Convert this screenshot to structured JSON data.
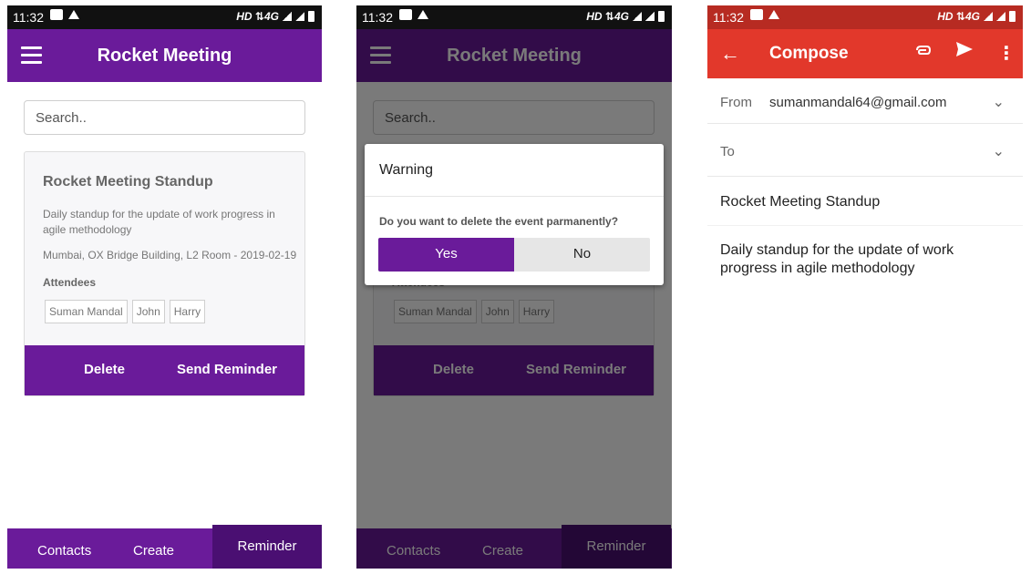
{
  "status_bar": {
    "time": "11:32",
    "network": "HD ⇅4G"
  },
  "app": {
    "title": "Rocket Meeting"
  },
  "search": {
    "placeholder": "Search.."
  },
  "event": {
    "title": "Rocket Meeting Standup",
    "description": "Daily standup for the update of work progress in agile methodology",
    "location_date": "Mumbai, OX Bridge Building, L2 Room - 2019-02-19",
    "attendees_label": "Attendees",
    "attendees": [
      "Suman Mandal",
      "John",
      "Harry"
    ],
    "delete_label": "Delete",
    "reminder_label": "Send Reminder"
  },
  "bottom_nav": {
    "contacts": "Contacts",
    "create": "Create",
    "reminder": "Reminder",
    "active": "Reminder"
  },
  "dialog": {
    "title": "Warning",
    "message": "Do you want to delete the event parmanently?",
    "yes_label": "Yes",
    "no_label": "No"
  },
  "compose": {
    "title": "Compose",
    "from_label": "From",
    "from_value": "sumanmandal64@gmail.com",
    "to_label": "To",
    "subject": "Rocket Meeting Standup",
    "body": "Daily standup for the update of work progress in agile methodology"
  },
  "colors": {
    "primary": "#6a1b9a",
    "nav_active": "#4a0f72",
    "gmail_red": "#e2382b",
    "gmail_status": "#b72b22"
  },
  "icons": [
    "menu-icon",
    "arrow-back-icon",
    "attach-icon",
    "send-icon",
    "more-vert-icon",
    "chevron-down-icon"
  ]
}
